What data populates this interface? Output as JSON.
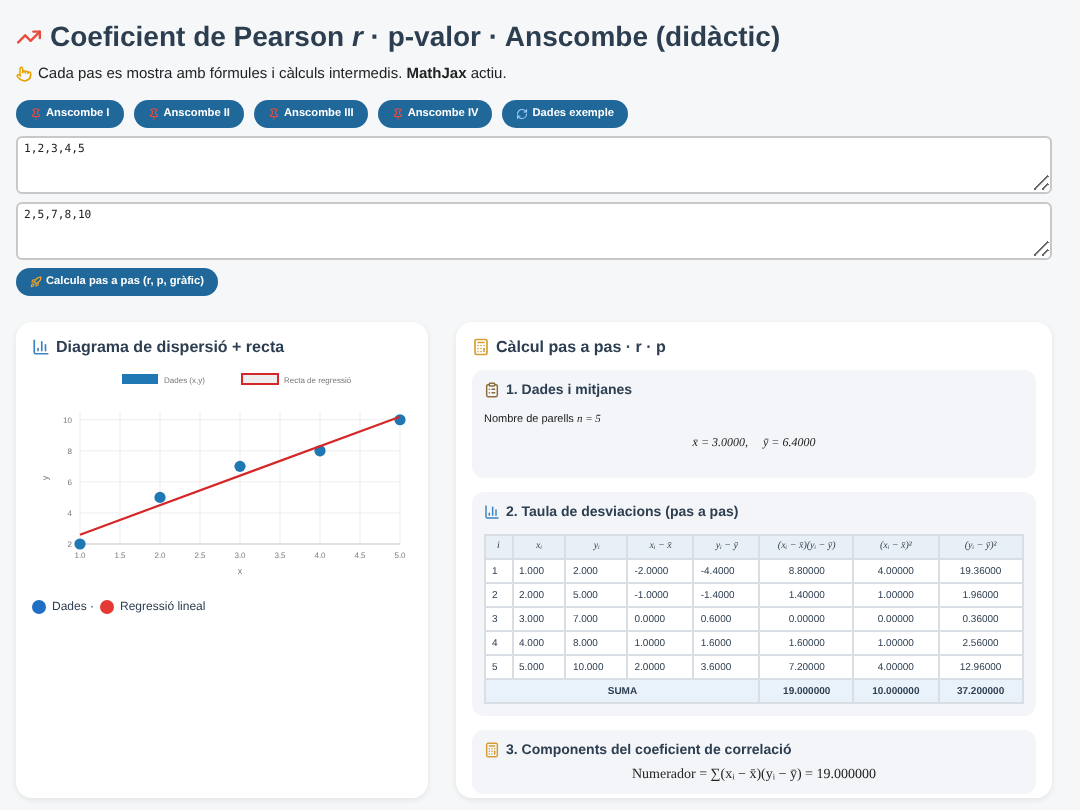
{
  "header": {
    "title": "Coeficient de Pearson",
    "title_symbol": "r",
    "title_rest": "· p-valor · Anscombe (didàctic)",
    "intro": "Cada pas es mostra amb fórmules i càlculs intermedis. **MathJax** actiu."
  },
  "presets": [
    {
      "label": "Anscombe I",
      "kind": "preset"
    },
    {
      "label": "Anscombe II",
      "kind": "preset"
    },
    {
      "label": "Anscombe III",
      "kind": "preset"
    },
    {
      "label": "Anscombe IV",
      "kind": "preset"
    },
    {
      "label": "Dades exemple",
      "kind": "example"
    }
  ],
  "inputs": [
    {
      "value": "1,2,3,4,5"
    },
    {
      "value": "2,5,7,8,10"
    }
  ],
  "compute_button": {
    "label": "Calcula pas a pas (r, p, gràfic)"
  },
  "chart_panel": {
    "title": "Diagrama de dispersió + recta",
    "chart_data": {
      "type": "scatter",
      "grid": true,
      "legend": "top",
      "xlabel": "x",
      "ylabel": "y",
      "xlim": [
        1,
        5
      ],
      "ylim": [
        2,
        10.5
      ],
      "xticks": [
        {
          "value": 1,
          "label": "1.0"
        },
        1.5,
        {
          "value": 2,
          "label": "2.0"
        },
        2.5,
        {
          "value": 3,
          "label": "3.0"
        },
        3.5,
        {
          "value": 4,
          "label": "4.0"
        },
        4.5,
        {
          "value": 5,
          "label": "5.0"
        }
      ],
      "yticks": [
        2,
        4,
        6,
        8,
        10
      ],
      "series": [
        {
          "name": "Dades (x,y)",
          "type": "scatter",
          "color": "#1f77b4",
          "x": [
            1,
            2,
            3,
            4,
            5
          ],
          "values": [
            2,
            5,
            7,
            8,
            10
          ]
        },
        {
          "name": "Recta de regressió",
          "type": "line",
          "color": "#d62728",
          "x": [
            1,
            5
          ],
          "values": [
            2.6,
            10.2
          ]
        }
      ]
    },
    "legend": [
      {
        "label": "Dades ·",
        "color": "#1f6fc4"
      },
      {
        "label": "Regressió lineal",
        "color": "#e53935"
      }
    ]
  },
  "calc_panel": {
    "title": "Càlcul pas a pas · r · p",
    "step1": {
      "title": "1. Dades i mitjanes",
      "count_text": "Nombre de parells",
      "count_formula": "n = 5",
      "means": "x̄ = 3.0000,     ȳ = 6.4000"
    },
    "step2": {
      "title": "2. Taula de desviacions (pas a pas)",
      "columns": [
        "i",
        "xᵢ",
        "yᵢ",
        "xᵢ − x̄",
        "yᵢ − ȳ",
        "(xᵢ − x̄)(yᵢ − ȳ)",
        "(xᵢ − x̄)²",
        "(yᵢ − ȳ)²"
      ],
      "rows": [
        [
          "1",
          "1.000",
          "2.000",
          "-2.0000",
          "-4.4000",
          "8.80000",
          "4.00000",
          "19.36000"
        ],
        [
          "2",
          "2.000",
          "5.000",
          "-1.0000",
          "-1.4000",
          "1.40000",
          "1.00000",
          "1.96000"
        ],
        [
          "3",
          "3.000",
          "7.000",
          "0.0000",
          "0.6000",
          "0.00000",
          "0.00000",
          "0.36000"
        ],
        [
          "4",
          "4.000",
          "8.000",
          "1.0000",
          "1.6000",
          "1.60000",
          "1.00000",
          "2.56000"
        ],
        [
          "5",
          "5.000",
          "10.000",
          "2.0000",
          "3.6000",
          "7.20000",
          "4.00000",
          "12.96000"
        ]
      ],
      "sum_row": {
        "label": "SUMA",
        "values": [
          "19.000000",
          "10.000000",
          "37.200000"
        ]
      }
    },
    "step3": {
      "title": "3. Components del coeficient de correlació",
      "formula": "Numerador = ∑(xᵢ − x̄)(yᵢ − ȳ) = 19.000000"
    }
  }
}
